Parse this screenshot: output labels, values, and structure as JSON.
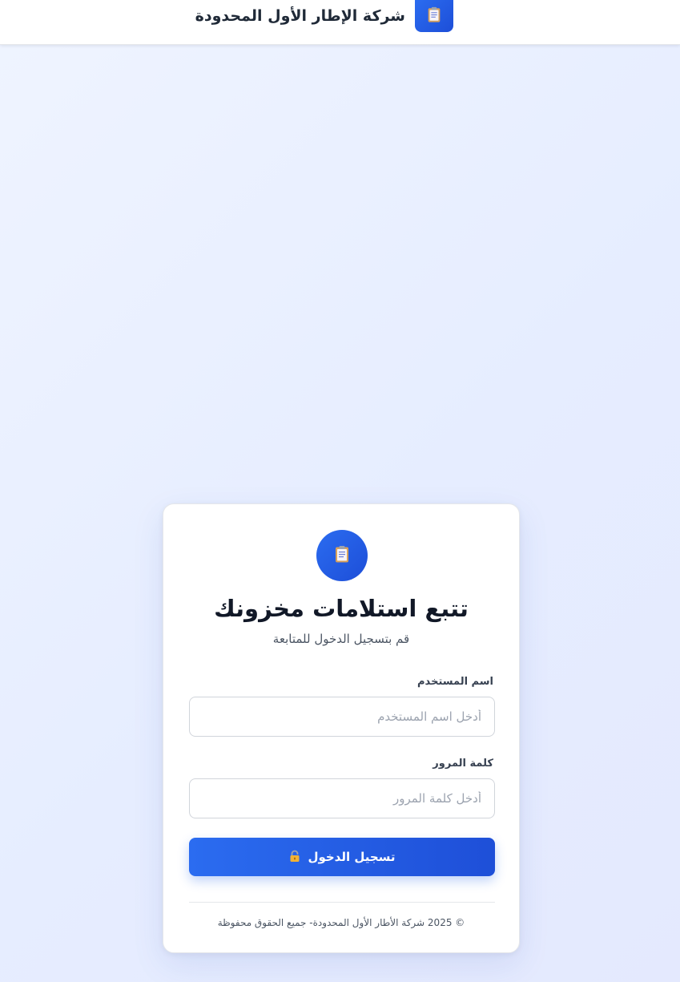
{
  "header": {
    "company_name": "شركة الإطار الأول المحدودة",
    "logo_icon": "clipboard-icon",
    "logo_color": "#2563eb"
  },
  "login": {
    "icon": "clipboard-icon",
    "title": "تتبع استلامات مخزونك",
    "subtitle": "قم بتسجيل الدخول للمتابعة",
    "username": {
      "label": "اسم المستخدم",
      "placeholder": "أدخل اسم المستخدم",
      "value": ""
    },
    "password": {
      "label": "كلمة المرور",
      "placeholder": "أدخل كلمة المرور",
      "value": ""
    },
    "submit": {
      "label": "تسجيل الدخول",
      "icon": "lock-icon"
    },
    "footer": "© 2025 شركة الأطار الأول المحدودة- جميع الحقوق محفوظة"
  },
  "colors": {
    "accent": "#2563eb",
    "background": "#e8eeff",
    "card": "#ffffff",
    "text_primary": "#111827",
    "text_secondary": "#4b5563"
  }
}
